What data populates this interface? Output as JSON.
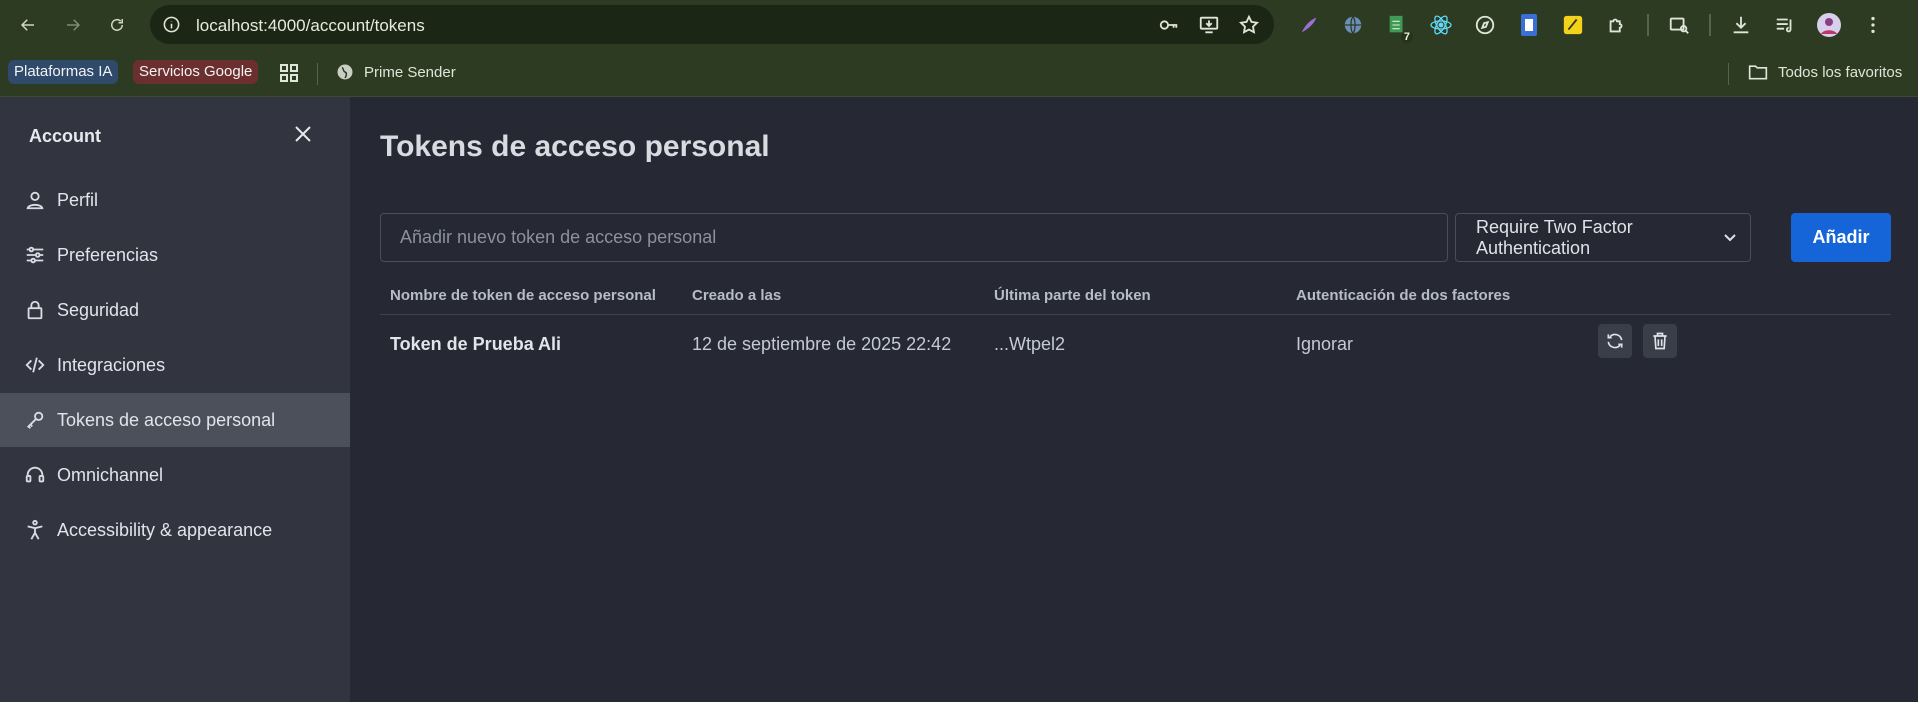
{
  "browser": {
    "url": "localhost:4000/account/tokens",
    "extension_badge": "7"
  },
  "bookmarks": {
    "chip_ia": "Plataformas IA",
    "chip_google": "Servicios Google",
    "prime": "Prime Sender",
    "favorites": "Todos los favoritos"
  },
  "sidebar": {
    "header": "Account",
    "items": [
      {
        "label": "Perfil",
        "icon": "user-icon"
      },
      {
        "label": "Preferencias",
        "icon": "sliders-icon"
      },
      {
        "label": "Seguridad",
        "icon": "lock-icon"
      },
      {
        "label": "Integraciones",
        "icon": "code-icon"
      },
      {
        "label": "Tokens de acceso personal",
        "icon": "key-icon",
        "active": true
      },
      {
        "label": "Omnichannel",
        "icon": "headset-icon"
      },
      {
        "label": "Accessibility & appearance",
        "icon": "accessibility-icon"
      }
    ]
  },
  "main": {
    "title": "Tokens de acceso personal",
    "input_placeholder": "Añadir nuevo token de acceso personal",
    "select_value": "Require Two Factor Authentication",
    "add_button": "Añadir",
    "table": {
      "headers": [
        "Nombre de token de acceso personal",
        "Creado a las",
        "Última parte del token",
        "Autenticación de dos factores"
      ],
      "rows": [
        {
          "name": "Token de Prueba Ali",
          "created": "12 de septiembre de 2025 22:42",
          "last_part": "...Wtpel2",
          "two_factor": "Ignorar"
        }
      ]
    }
  },
  "colors": {
    "accent": "#1565d8",
    "sidebar_bg": "#32353f",
    "main_bg": "#262834",
    "browser_bg": "#2c3b22"
  }
}
